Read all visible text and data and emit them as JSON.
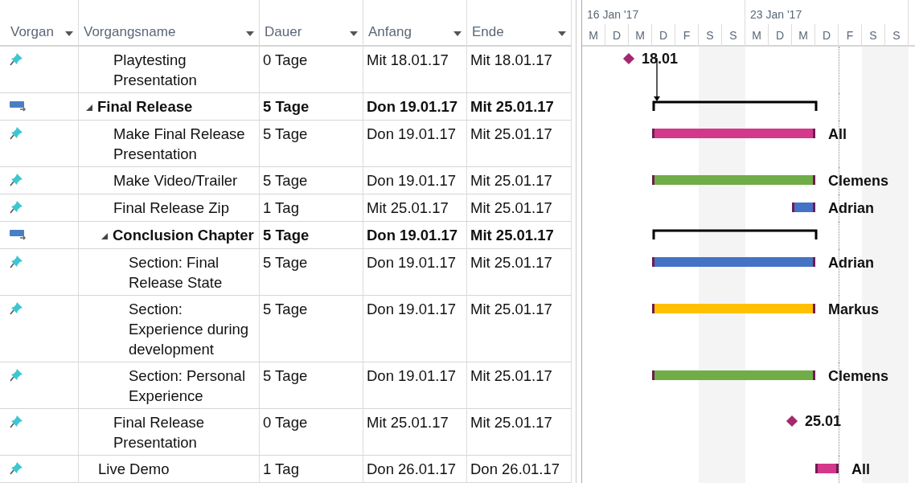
{
  "columns": [
    "Vorgan",
    "Vorgangsname",
    "Dauer",
    "Anfang",
    "Ende"
  ],
  "timescale": [
    {
      "label": "16 Jan '17",
      "days": [
        "M",
        "D",
        "M",
        "D",
        "F",
        "S",
        "S"
      ]
    },
    {
      "label": "23 Jan '17",
      "days": [
        "M",
        "D",
        "M",
        "D",
        "F",
        "S",
        "S"
      ]
    }
  ],
  "tasks": [
    {
      "children": [
        {
          "kind": "task",
          "name": "Playtesting Presentation",
          "duration": "0 Tage",
          "start": "Mit 18.01.17",
          "end": "Mit 18.01.17",
          "bar": {
            "kind": "milestone",
            "label": "18.01",
            "color": "#a5286e"
          }
        }
      ]
    },
    {
      "kind": "summary",
      "name": "Final Release",
      "duration": "5 Tage",
      "start": "Don 19.01.17",
      "end": "Mit 25.01.17",
      "bar": {
        "kind": "summary"
      },
      "children": [
        {
          "kind": "task",
          "name": "Make Final Release Presentation",
          "duration": "5 Tage",
          "start": "Don 19.01.17",
          "end": "Mit 25.01.17",
          "bar": {
            "kind": "task",
            "label": "All",
            "color": "#d4388a"
          }
        },
        {
          "kind": "task",
          "name": "Make Video/Trailer",
          "duration": "5 Tage",
          "start": "Don 19.01.17",
          "end": "Mit 25.01.17",
          "bar": {
            "kind": "task",
            "label": "Clemens",
            "color": "#70ad47"
          }
        },
        {
          "kind": "task",
          "name": "Final Release Zip",
          "duration": "1 Tag",
          "start": "Mit 25.01.17",
          "end": "Mit 25.01.17",
          "bar": {
            "kind": "task",
            "label": "Adrian",
            "color": "#4472c4"
          }
        },
        {
          "kind": "summary",
          "name": "Conclusion Chapter",
          "duration": "5 Tage",
          "start": "Don 19.01.17",
          "end": "Mit 25.01.17",
          "bar": {
            "kind": "summary"
          },
          "children": [
            {
              "kind": "task",
              "name": "Section: Final Release State",
              "duration": "5 Tage",
              "start": "Don 19.01.17",
              "end": "Mit 25.01.17",
              "bar": {
                "kind": "task",
                "label": "Adrian",
                "color": "#4472c4"
              }
            },
            {
              "kind": "task",
              "name": "Section: Experience during development",
              "duration": "5 Tage",
              "start": "Don 19.01.17",
              "end": "Mit 25.01.17",
              "bar": {
                "kind": "task",
                "label": "Markus",
                "color": "#ffc000"
              }
            },
            {
              "kind": "task",
              "name": "Section: Personal Experience",
              "duration": "5 Tage",
              "start": "Don 19.01.17",
              "end": "Mit 25.01.17",
              "bar": {
                "kind": "task",
                "label": "Clemens",
                "color": "#70ad47"
              }
            }
          ]
        },
        {
          "kind": "task",
          "name": "Final Release Presentation",
          "duration": "0 Tage",
          "start": "Mit 25.01.17",
          "end": "Mit 25.01.17",
          "bar": {
            "kind": "milestone",
            "label": "25.01",
            "color": "#a5286e"
          }
        }
      ]
    },
    {
      "kind": "task",
      "name": "Live Demo",
      "duration": "1 Tag",
      "start": "Don 26.01.17",
      "end": "Don 26.01.17",
      "bar": {
        "kind": "task",
        "label": "All",
        "color": "#d4388a"
      }
    }
  ]
}
